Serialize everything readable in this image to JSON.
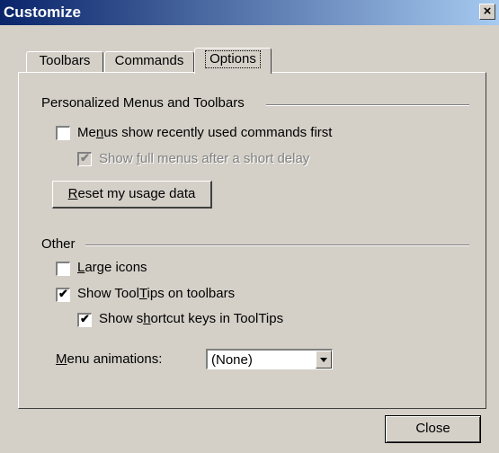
{
  "window": {
    "title": "Customize",
    "close_glyph": "×"
  },
  "tabs": [
    {
      "label": "Toolbars"
    },
    {
      "label": "Commands"
    },
    {
      "label": "Options"
    }
  ],
  "selected_tab": "Options",
  "personalized": {
    "heading": "Personalized Menus and Toolbars",
    "menus_recent": {
      "pre": "Me",
      "mnemonic": "n",
      "post": "us show recently used commands first",
      "checked": false
    },
    "full_menus_delay": {
      "pre": "Show ",
      "mnemonic": "f",
      "post": "ull menus after a short delay",
      "checked": true,
      "enabled": false
    },
    "reset_button": {
      "pre": "",
      "mnemonic": "R",
      "post": "eset my usage data"
    }
  },
  "other": {
    "heading": "Other",
    "large_icons": {
      "pre": "",
      "mnemonic": "L",
      "post": "arge icons",
      "checked": false
    },
    "show_tooltips": {
      "pre": "Show Tool",
      "mnemonic": "T",
      "post": "ips on toolbars",
      "checked": true
    },
    "shortcut_keys": {
      "pre": "Show s",
      "mnemonic": "h",
      "post": "ortcut keys in ToolTips",
      "checked": true
    },
    "menu_animations": {
      "pre": "",
      "mnemonic": "M",
      "post": "enu animations:",
      "value": "(None)"
    }
  },
  "footer": {
    "close_label": "Close"
  },
  "check_glyph": "✔"
}
